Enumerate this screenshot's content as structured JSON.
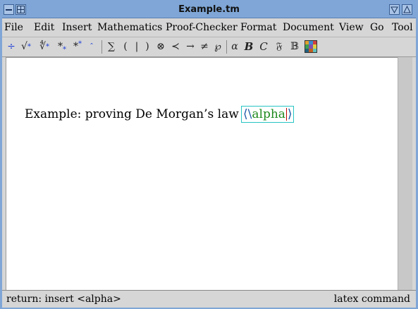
{
  "window": {
    "title": "Example.tm"
  },
  "menu": {
    "items": [
      "File",
      "Edit",
      "Insert",
      "Mathematics",
      "Proof-Checker",
      "Format",
      "Document",
      "View",
      "Go",
      "Tool"
    ]
  },
  "toolbar": {
    "fraction": "÷",
    "sqrt": "√",
    "nroot": "∜",
    "star": "*",
    "sum": "∑",
    "lparen": "(",
    "bar": "|",
    "rparen": ")",
    "otimes": "⊗",
    "prec": "≺",
    "arrow": "→",
    "neq": "≠",
    "wp": "℘",
    "alpha": "α",
    "bold_b": "B",
    "cal_c": "C",
    "frak_f": "𝔉",
    "bb_b": "𝔹"
  },
  "document": {
    "text": "Example: proving De Morgan’s law",
    "macro_open": "⟨",
    "macro_backslash": "\\",
    "macro_name": "alpha",
    "macro_close": "⟩"
  },
  "status": {
    "left": "return: insert <alpha>",
    "right": "latex command"
  },
  "colors": {
    "titlebar": "#7fa6d6",
    "macro_box": "#27c4c4",
    "macro_name": "#1f8a1f",
    "caret": "#c00000",
    "toolbar_blue": "#1e3fd6"
  }
}
